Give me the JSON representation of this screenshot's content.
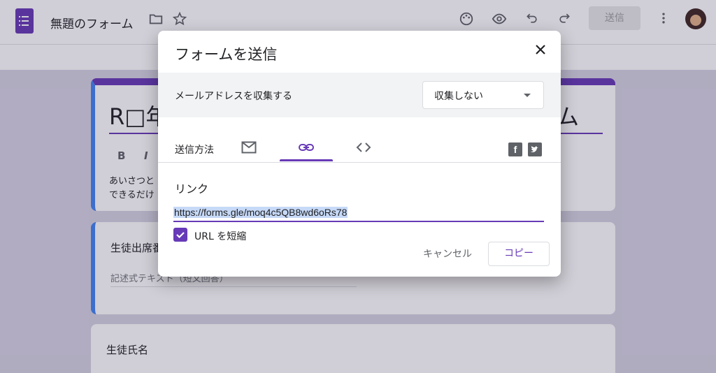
{
  "header": {
    "doc_title": "無題のフォーム",
    "send_label": "送信"
  },
  "form": {
    "title_start": "R□年",
    "title_end": "ム",
    "format_bold": "B",
    "format_italic": "I",
    "description_line1": "あいさつと",
    "description_line2": "できるだけ",
    "q1_title": "生徒出席番",
    "q1_hint": "記述式テキスト（短文回答）",
    "q2_title": "生徒氏名"
  },
  "dialog": {
    "title": "フォームを送信",
    "collect_email_label": "メールアドレスを収集する",
    "collect_email_value": "収集しない",
    "send_method_label": "送信方法",
    "tabs": [
      {
        "name": "email",
        "icon": "mail-icon"
      },
      {
        "name": "link",
        "icon": "link-icon",
        "selected": true
      },
      {
        "name": "embed",
        "icon": "code-icon"
      }
    ],
    "link_heading": "リンク",
    "link_url": "https://forms.gle/moq4c5QB8wd6oRs78",
    "shorten_url_label": "URL を短縮",
    "shorten_url_checked": true,
    "cancel_label": "キャンセル",
    "copy_label": "コピー"
  },
  "colors": {
    "accent": "#673ab7",
    "accent_blue": "#4285f4"
  }
}
